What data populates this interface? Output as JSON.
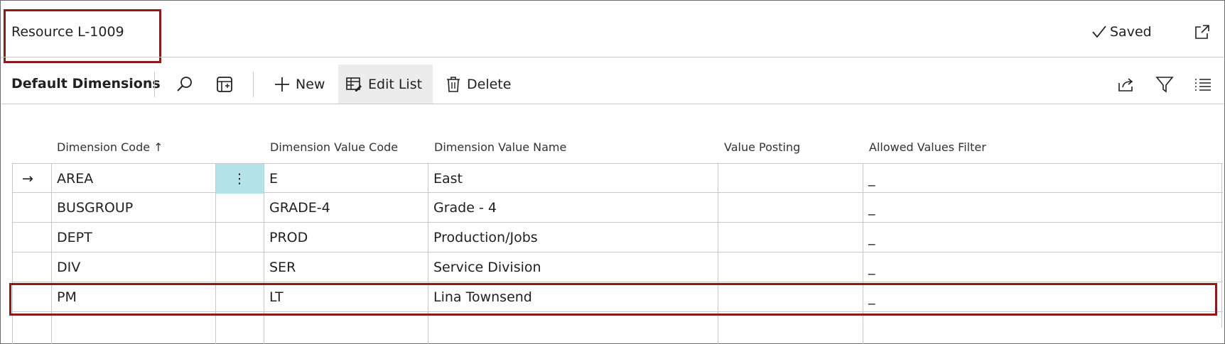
{
  "window": {
    "title": "Resource L-1009",
    "saved_label": "Saved"
  },
  "toolbar": {
    "title": "Default Dimensions",
    "new_label": "New",
    "edit_list_label": "Edit List",
    "delete_label": "Delete"
  },
  "grid": {
    "columns": [
      "Dimension Code ↑",
      "Dimension Value Code",
      "Dimension Value Name",
      "Value Posting",
      "Allowed Values Filter"
    ],
    "rows": [
      {
        "code": "AREA",
        "value_code": "E",
        "value_name": "East",
        "value_posting": "",
        "allowed_filter": "_"
      },
      {
        "code": "BUSGROUP",
        "value_code": "GRADE-4",
        "value_name": "Grade - 4",
        "value_posting": "",
        "allowed_filter": "_"
      },
      {
        "code": "DEPT",
        "value_code": "PROD",
        "value_name": "Production/Jobs",
        "value_posting": "",
        "allowed_filter": "_"
      },
      {
        "code": "DIV",
        "value_code": "SER",
        "value_name": "Service Division",
        "value_posting": "",
        "allowed_filter": "_"
      },
      {
        "code": "PM",
        "value_code": "LT",
        "value_name": "Lina Townsend",
        "value_posting": "",
        "allowed_filter": "_"
      }
    ],
    "row_marker_glyph": "→",
    "row_menu_glyph": "⋮"
  },
  "colors": {
    "highlight_border": "#8b1a1a",
    "selected_cell_bg": "#b4e3e8",
    "active_button_bg": "#ececec"
  },
  "icons": [
    "checkmark-icon",
    "popout-icon",
    "search-icon",
    "layout-icon",
    "plus-icon",
    "edit-list-icon",
    "trash-icon",
    "share-icon",
    "filter-icon",
    "list-icon"
  ]
}
